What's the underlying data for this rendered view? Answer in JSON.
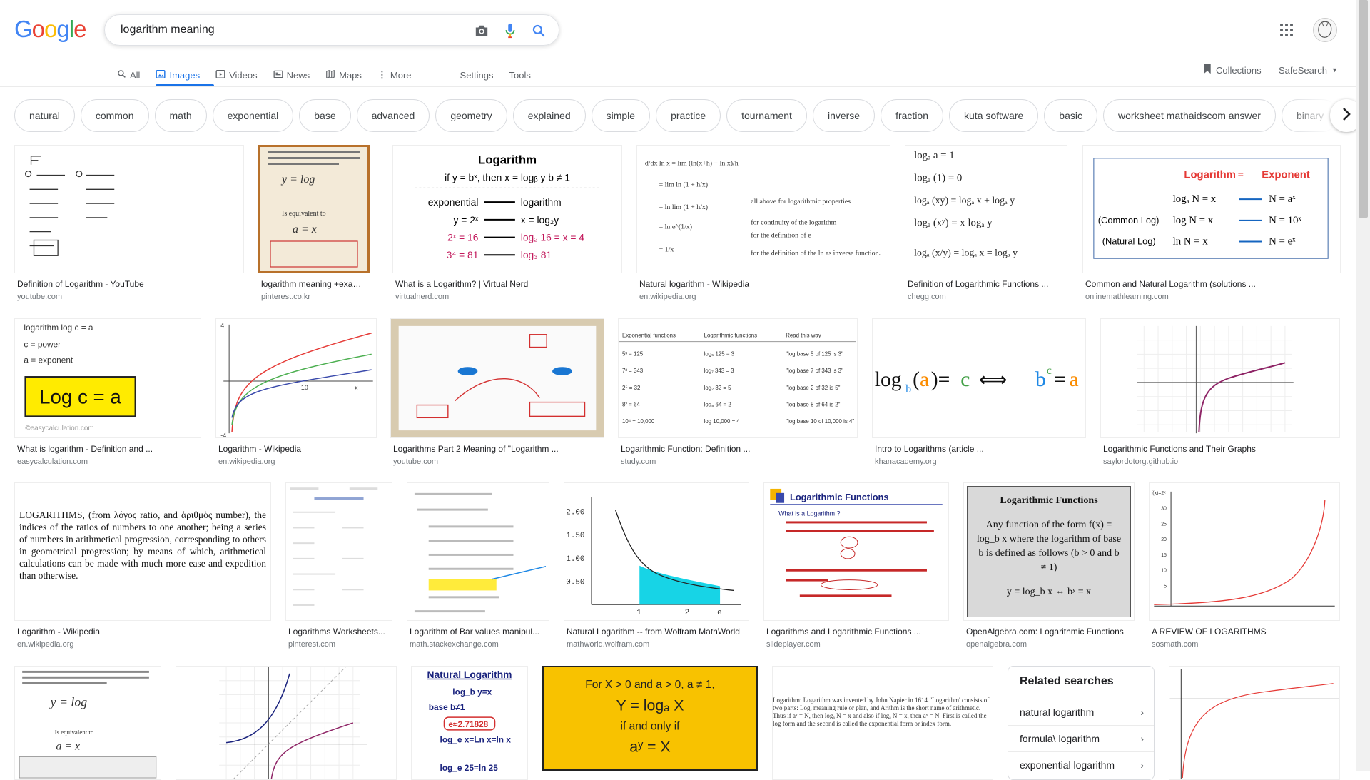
{
  "header": {
    "logo_text": "Google",
    "search_value": "logarithm meaning",
    "icons": [
      "camera-icon",
      "mic-icon",
      "search-icon",
      "apps-icon"
    ]
  },
  "tabs": [
    {
      "label": "All",
      "icon": "search-icon"
    },
    {
      "label": "Images",
      "icon": "image-icon",
      "active": true
    },
    {
      "label": "Videos",
      "icon": "video-icon"
    },
    {
      "label": "News",
      "icon": "news-icon"
    },
    {
      "label": "Maps",
      "icon": "map-icon"
    },
    {
      "label": "More",
      "icon": "more-icon"
    },
    {
      "label": "Settings"
    },
    {
      "label": "Tools"
    }
  ],
  "right_tools": {
    "collections": "Collections",
    "safesearch": "SafeSearch"
  },
  "chips": [
    "natural",
    "common",
    "math",
    "exponential",
    "base",
    "advanced",
    "geometry",
    "explained",
    "simple",
    "practice",
    "tournament",
    "inverse",
    "fraction",
    "kuta software",
    "basic",
    "worksheet mathaidscom answer",
    "binary"
  ],
  "results": [
    {
      "caption": "Definition of Logarithm - YouTube",
      "source": "youtube.com"
    },
    {
      "caption": "logarithm meaning +exam ...",
      "source": "pinterest.co.kr"
    },
    {
      "caption": "What is a Logarithm? | Virtual Nerd",
      "source": "virtualnerd.com"
    },
    {
      "caption": "Natural logarithm - Wikipedia",
      "source": "en.wikipedia.org"
    },
    {
      "caption": "Definition of Logarithmic Functions ...",
      "source": "chegg.com"
    },
    {
      "caption": "Common and Natural Logarithm (solutions ...",
      "source": "onlinemathlearning.com"
    },
    {
      "caption": "What is logarithm - Definition and ...",
      "source": "easycalculation.com"
    },
    {
      "caption": "Logarithm - Wikipedia",
      "source": "en.wikipedia.org"
    },
    {
      "caption": "Logarithms Part 2 Meaning of \"Logarithm ...",
      "source": "youtube.com"
    },
    {
      "caption": "Logarithmic Function: Definition ...",
      "source": "study.com"
    },
    {
      "caption": "Intro to Logarithms (article ...",
      "source": "khanacademy.org"
    },
    {
      "caption": "Logarithmic Functions and Their Graphs",
      "source": "saylordotorg.github.io"
    },
    {
      "caption": "Logarithm - Wikipedia",
      "source": "en.wikipedia.org"
    },
    {
      "caption": "Logarithms Worksheets...",
      "source": "pinterest.com"
    },
    {
      "caption": "Logarithm of Bar values manipul...",
      "source": "math.stackexchange.com"
    },
    {
      "caption": "Natural Logarithm -- from Wolfram MathWorld",
      "source": "mathworld.wolfram.com"
    },
    {
      "caption": "Logarithms and Logarithmic Functions ...",
      "source": "slideplayer.com"
    },
    {
      "caption": "OpenAlgebra.com: Logarithmic Functions",
      "source": "openalgebra.com"
    },
    {
      "caption": "A REVIEW OF LOGARITHMS",
      "source": "sosmath.com"
    }
  ],
  "thumb_text": {
    "t3_title": "Logarithm",
    "t3_line1": "if y = bˣ, then x = logᵦ y   b ≠ 1",
    "t3_l2a": "exponential",
    "t3_l2b": "logarithm",
    "t3_l3a": "y = 2ˣ",
    "t3_l3b": "x = log₂y",
    "t3_l4a": "2ˣ = 16",
    "t3_l4b": "log₂ 16 = x = 4",
    "t3_l5a": "3⁴ = 81",
    "t3_l5b": "log₃ 81",
    "t5_lines": [
      "logₐ a = 1",
      "logₐ (1) = 0",
      "logₐ (xy) = logₐ x + logₐ y",
      "logₐ (xʸ) = x logₐ y",
      "logₐ (x/y) = logₐ x = logₐ y"
    ],
    "t6_h1": "Logarithm",
    "t6_h2": "=",
    "t6_h3": "Exponent",
    "t6_r1a": "logₐ N = x",
    "t6_r1b": "N = aˣ",
    "t6_r2l": "(Common Log)",
    "t6_r2a": "log N = x",
    "t6_r2b": "N = 10ˣ",
    "t6_r3l": "(Natural Log)",
    "t6_r3a": "ln N = x",
    "t6_r3b": "N = eˣ",
    "t7_l1": "logarithm log c = a",
    "t7_l2": "c = power",
    "t7_l3": "a = exponent",
    "t7_box": "Log c = a",
    "t7_copy": "©easycalculation.com",
    "t10_h1": "Exponential functions",
    "t10_h2": "Logarithmic functions",
    "t10_h3": "Read this way",
    "t10_rows": [
      [
        "5³ = 125",
        "log₅ 125 = 3",
        "\"log base 5 of 125 is 3\""
      ],
      [
        "7³ = 343",
        "log₇ 343 = 3",
        "\"log base 7 of 343 is 3\""
      ],
      [
        "2⁵ = 32",
        "log₂ 32 = 5",
        "\"log base 2 of 32 is 5\""
      ],
      [
        "8² = 64",
        "log₈ 64 = 2",
        "\"log base 8 of 64 is 2\""
      ],
      [
        "10⁴ = 10,000",
        "log 10,000 = 4",
        "\"log base 10 of 10,000 is 4\""
      ]
    ],
    "t11": "log_b(a) = c  ⟺  b^c = a",
    "t13": "LOGARITHMS, (from λόγος ratio, and ἀριθμὸς number), the indices of the ratios of numbers to one another; being a series of numbers in arithmetical progression, corresponding to others in geometrical progression; by means of which, arithmetical calculations can be made with much more ease and expedition than otherwise.",
    "t17_title": "Logarithmic Functions",
    "t17_sub": "What is a Logarithm ?",
    "t18_title": "Logarithmic Functions",
    "t18_body": "Any function of the form f(x) = log_b x  where the logarithm of base b is defined as follows (b > 0 and b ≠ 1)",
    "t18_eq": "y = log_b x   ⇔   bʸ = x",
    "r4c_title": "Natural Logarithm",
    "r4c_l1": "log_b y=x",
    "r4c_l2": "base   b≠1",
    "r4c_l3": "e≈2.71828",
    "r4c_l4": "log_e x=Ln x=ln x",
    "r4c_l5": "log_e 25=ln 25",
    "r4d_l1": "For X > 0 and a > 0, a ≠ 1,",
    "r4d_l2": "Y = logₐ X",
    "r4d_l3": "if and only if",
    "r4d_l4": "aʸ = X",
    "r4e_text": "Logarithm: Logarithm was invented by John Napier in 1614. 'Logarithm' consists of two parts: Log, meaning rule or plan, and Arithm is the short name of arithmetic. Thus if aˣ = N, then logₐ N = x and also if logₐ N = x, then aˣ = N. First is called the log form and the second is called the exponential form or index form."
  },
  "related": {
    "title": "Related searches",
    "items": [
      "natural logarithm",
      "formula\\ logarithm",
      "exponential logarithm"
    ]
  },
  "colors": {
    "accent": "#1a73e8",
    "link_gray": "#70757a",
    "chip_border": "#dadce0"
  }
}
